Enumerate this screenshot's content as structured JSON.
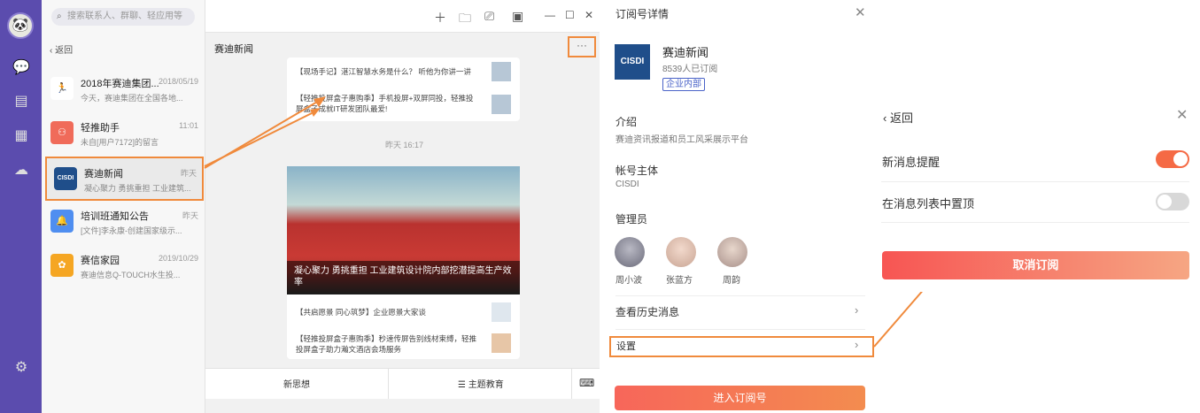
{
  "rail": {
    "icons": [
      "avatar-icon",
      "chat-icon",
      "contacts-icon",
      "apps-icon",
      "cloud-icon",
      "settings-icon"
    ]
  },
  "list": {
    "search_placeholder": "搜索联系人、群聊、轻应用等",
    "back_label": "返回",
    "items": [
      {
        "name": "2018年赛迪集团...",
        "sub": "今天，赛迪集团在全国各地...",
        "time": "2018/05/19",
        "color": "#ffffff"
      },
      {
        "name": "轻推助手",
        "sub": "未自[用户7172]的留言",
        "time": "11:01",
        "color": "#f06b5a"
      },
      {
        "name": "赛迪新闻",
        "sub": "凝心聚力 勇挑重担 工业建筑...",
        "time": "昨天",
        "color": "#1f4e8a"
      },
      {
        "name": "培训班通知公告",
        "sub": "[文件]李永康-创建国家级示...",
        "time": "昨天",
        "color": "#4f8ef0"
      },
      {
        "name": "赛信家园",
        "sub": "赛迪信息Q-TOUCH水生投...",
        "time": "2019/10/29",
        "color": "#f5a623"
      }
    ]
  },
  "conv": {
    "title": "赛迪新闻",
    "more": "···",
    "art1": "【现场手记】湛江智慧水务是什么？ 听他为你讲一讲",
    "art2": "【轻推投屏盒子惠购季】手机投屏+双屏同投，轻推投屏盒子成就IT研发团队最爱!",
    "timestamp": "昨天 16:17",
    "caption": "凝心聚力 勇挑重担 工业建筑设计院内部挖潜提高生产效率",
    "art3": "【共启愿景 同心筑梦】企业愿景大家谈",
    "art4": "【轻推投屏盒子惠购季】秒速传屏告别线材束缚，轻推投屏盒子助力瀚文酒店会场服务",
    "tab1": "新思想",
    "tab2": "☰ 主题教育"
  },
  "detail": {
    "title": "订阅号详情",
    "name": "赛迪新闻",
    "logo": "CISDI",
    "subs": "8539人已订阅",
    "tag": "企业内部",
    "intro_label": "介绍",
    "intro_value": "赛迪资讯报道和员工风采展示平台",
    "owner_label": "帐号主体",
    "owner_value": "CISDI",
    "admin_label": "管理员",
    "admins": [
      "周小波",
      "张蓝方",
      "周韵"
    ],
    "history": "查看历史消息",
    "settings": "设置",
    "enter": "进入订阅号"
  },
  "settings_panel": {
    "back": "返回",
    "notify_label": "新消息提醒",
    "notify_on": true,
    "pin_label": "在消息列表中置顶",
    "pin_on": false,
    "unsubscribe": "取消订阅"
  },
  "colors": {
    "rail": "#5b4cae",
    "accent": "#f08a3c",
    "toggle_on": "#f56a45"
  }
}
